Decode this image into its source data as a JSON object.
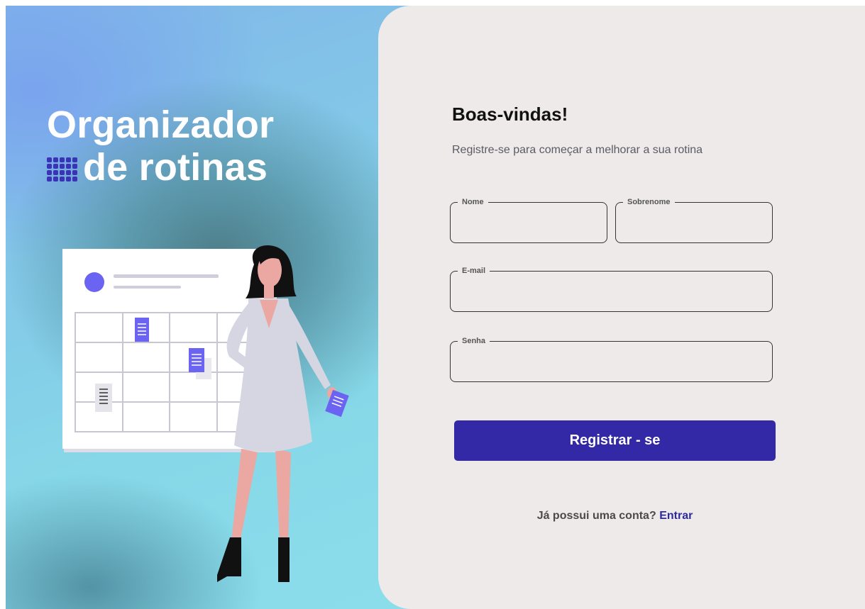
{
  "brand": {
    "title_line1": "Organizador",
    "title_line2": "de rotinas",
    "logo_icon": "grid-dots-icon"
  },
  "form": {
    "heading": "Boas-vindas!",
    "subtitle": "Registre-se para começar a melhorar a sua rotina",
    "fields": {
      "first_name": {
        "label": "Nome",
        "value": ""
      },
      "last_name": {
        "label": "Sobrenome",
        "value": ""
      },
      "email": {
        "label": "E-mail",
        "value": ""
      },
      "password": {
        "label": "Senha",
        "value": ""
      }
    },
    "submit_label": "Registrar - se",
    "login_prompt": "Já possui uma conta?",
    "login_link": "Entrar"
  },
  "colors": {
    "primary": "#3329a6",
    "panel_bg": "#eeeae9",
    "accent_purple": "#6b63f2"
  }
}
